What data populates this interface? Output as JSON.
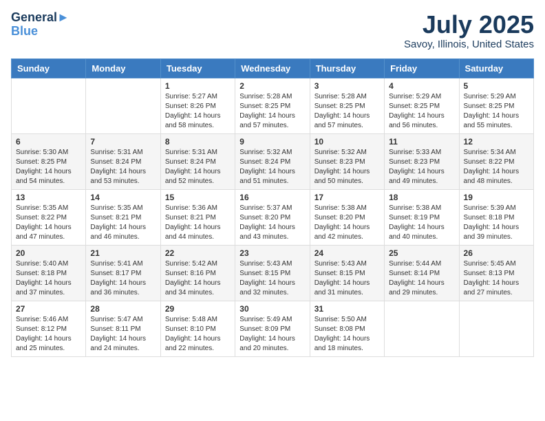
{
  "header": {
    "logo_line1": "General",
    "logo_line2": "Blue",
    "month_title": "July 2025",
    "location": "Savoy, Illinois, United States"
  },
  "days_of_week": [
    "Sunday",
    "Monday",
    "Tuesday",
    "Wednesday",
    "Thursday",
    "Friday",
    "Saturday"
  ],
  "weeks": [
    [
      {
        "day": "",
        "sunrise": "",
        "sunset": "",
        "daylight": ""
      },
      {
        "day": "",
        "sunrise": "",
        "sunset": "",
        "daylight": ""
      },
      {
        "day": "1",
        "sunrise": "Sunrise: 5:27 AM",
        "sunset": "Sunset: 8:26 PM",
        "daylight": "Daylight: 14 hours and 58 minutes."
      },
      {
        "day": "2",
        "sunrise": "Sunrise: 5:28 AM",
        "sunset": "Sunset: 8:25 PM",
        "daylight": "Daylight: 14 hours and 57 minutes."
      },
      {
        "day": "3",
        "sunrise": "Sunrise: 5:28 AM",
        "sunset": "Sunset: 8:25 PM",
        "daylight": "Daylight: 14 hours and 57 minutes."
      },
      {
        "day": "4",
        "sunrise": "Sunrise: 5:29 AM",
        "sunset": "Sunset: 8:25 PM",
        "daylight": "Daylight: 14 hours and 56 minutes."
      },
      {
        "day": "5",
        "sunrise": "Sunrise: 5:29 AM",
        "sunset": "Sunset: 8:25 PM",
        "daylight": "Daylight: 14 hours and 55 minutes."
      }
    ],
    [
      {
        "day": "6",
        "sunrise": "Sunrise: 5:30 AM",
        "sunset": "Sunset: 8:25 PM",
        "daylight": "Daylight: 14 hours and 54 minutes."
      },
      {
        "day": "7",
        "sunrise": "Sunrise: 5:31 AM",
        "sunset": "Sunset: 8:24 PM",
        "daylight": "Daylight: 14 hours and 53 minutes."
      },
      {
        "day": "8",
        "sunrise": "Sunrise: 5:31 AM",
        "sunset": "Sunset: 8:24 PM",
        "daylight": "Daylight: 14 hours and 52 minutes."
      },
      {
        "day": "9",
        "sunrise": "Sunrise: 5:32 AM",
        "sunset": "Sunset: 8:24 PM",
        "daylight": "Daylight: 14 hours and 51 minutes."
      },
      {
        "day": "10",
        "sunrise": "Sunrise: 5:32 AM",
        "sunset": "Sunset: 8:23 PM",
        "daylight": "Daylight: 14 hours and 50 minutes."
      },
      {
        "day": "11",
        "sunrise": "Sunrise: 5:33 AM",
        "sunset": "Sunset: 8:23 PM",
        "daylight": "Daylight: 14 hours and 49 minutes."
      },
      {
        "day": "12",
        "sunrise": "Sunrise: 5:34 AM",
        "sunset": "Sunset: 8:22 PM",
        "daylight": "Daylight: 14 hours and 48 minutes."
      }
    ],
    [
      {
        "day": "13",
        "sunrise": "Sunrise: 5:35 AM",
        "sunset": "Sunset: 8:22 PM",
        "daylight": "Daylight: 14 hours and 47 minutes."
      },
      {
        "day": "14",
        "sunrise": "Sunrise: 5:35 AM",
        "sunset": "Sunset: 8:21 PM",
        "daylight": "Daylight: 14 hours and 46 minutes."
      },
      {
        "day": "15",
        "sunrise": "Sunrise: 5:36 AM",
        "sunset": "Sunset: 8:21 PM",
        "daylight": "Daylight: 14 hours and 44 minutes."
      },
      {
        "day": "16",
        "sunrise": "Sunrise: 5:37 AM",
        "sunset": "Sunset: 8:20 PM",
        "daylight": "Daylight: 14 hours and 43 minutes."
      },
      {
        "day": "17",
        "sunrise": "Sunrise: 5:38 AM",
        "sunset": "Sunset: 8:20 PM",
        "daylight": "Daylight: 14 hours and 42 minutes."
      },
      {
        "day": "18",
        "sunrise": "Sunrise: 5:38 AM",
        "sunset": "Sunset: 8:19 PM",
        "daylight": "Daylight: 14 hours and 40 minutes."
      },
      {
        "day": "19",
        "sunrise": "Sunrise: 5:39 AM",
        "sunset": "Sunset: 8:18 PM",
        "daylight": "Daylight: 14 hours and 39 minutes."
      }
    ],
    [
      {
        "day": "20",
        "sunrise": "Sunrise: 5:40 AM",
        "sunset": "Sunset: 8:18 PM",
        "daylight": "Daylight: 14 hours and 37 minutes."
      },
      {
        "day": "21",
        "sunrise": "Sunrise: 5:41 AM",
        "sunset": "Sunset: 8:17 PM",
        "daylight": "Daylight: 14 hours and 36 minutes."
      },
      {
        "day": "22",
        "sunrise": "Sunrise: 5:42 AM",
        "sunset": "Sunset: 8:16 PM",
        "daylight": "Daylight: 14 hours and 34 minutes."
      },
      {
        "day": "23",
        "sunrise": "Sunrise: 5:43 AM",
        "sunset": "Sunset: 8:15 PM",
        "daylight": "Daylight: 14 hours and 32 minutes."
      },
      {
        "day": "24",
        "sunrise": "Sunrise: 5:43 AM",
        "sunset": "Sunset: 8:15 PM",
        "daylight": "Daylight: 14 hours and 31 minutes."
      },
      {
        "day": "25",
        "sunrise": "Sunrise: 5:44 AM",
        "sunset": "Sunset: 8:14 PM",
        "daylight": "Daylight: 14 hours and 29 minutes."
      },
      {
        "day": "26",
        "sunrise": "Sunrise: 5:45 AM",
        "sunset": "Sunset: 8:13 PM",
        "daylight": "Daylight: 14 hours and 27 minutes."
      }
    ],
    [
      {
        "day": "27",
        "sunrise": "Sunrise: 5:46 AM",
        "sunset": "Sunset: 8:12 PM",
        "daylight": "Daylight: 14 hours and 25 minutes."
      },
      {
        "day": "28",
        "sunrise": "Sunrise: 5:47 AM",
        "sunset": "Sunset: 8:11 PM",
        "daylight": "Daylight: 14 hours and 24 minutes."
      },
      {
        "day": "29",
        "sunrise": "Sunrise: 5:48 AM",
        "sunset": "Sunset: 8:10 PM",
        "daylight": "Daylight: 14 hours and 22 minutes."
      },
      {
        "day": "30",
        "sunrise": "Sunrise: 5:49 AM",
        "sunset": "Sunset: 8:09 PM",
        "daylight": "Daylight: 14 hours and 20 minutes."
      },
      {
        "day": "31",
        "sunrise": "Sunrise: 5:50 AM",
        "sunset": "Sunset: 8:08 PM",
        "daylight": "Daylight: 14 hours and 18 minutes."
      },
      {
        "day": "",
        "sunrise": "",
        "sunset": "",
        "daylight": ""
      },
      {
        "day": "",
        "sunrise": "",
        "sunset": "",
        "daylight": ""
      }
    ]
  ]
}
